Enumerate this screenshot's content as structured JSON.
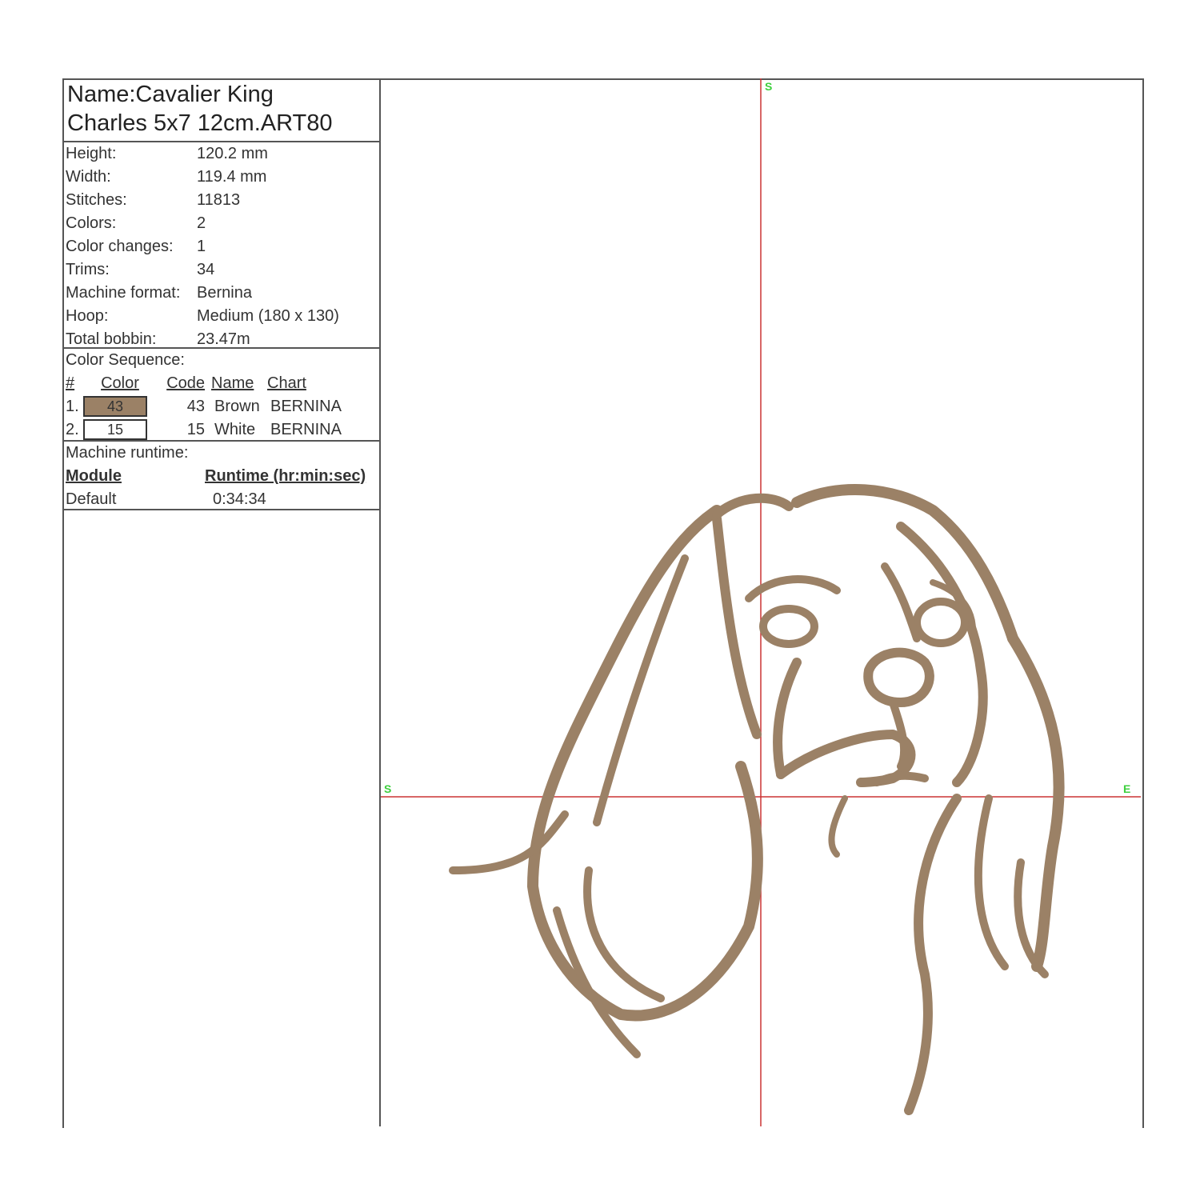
{
  "info": {
    "name_line1": "Name:Cavalier King",
    "name_line2": "Charles 5x7 12cm.ART80",
    "stats": [
      {
        "label": "Height:",
        "value": "120.2 mm"
      },
      {
        "label": "Width:",
        "value": "119.4 mm"
      },
      {
        "label": "Stitches:",
        "value": "11813"
      },
      {
        "label": "Colors:",
        "value": "2"
      },
      {
        "label": "Color changes:",
        "value": "1"
      },
      {
        "label": "Trims:",
        "value": "34"
      },
      {
        "label": "Machine format:",
        "value": "Bernina"
      },
      {
        "label": "Hoop:",
        "value": "Medium (180 x 130)"
      },
      {
        "label": "Total bobbin:",
        "value": "23.47m"
      }
    ],
    "color_sequence": {
      "title": "Color Sequence:",
      "headers": {
        "num": "#",
        "color": "Color",
        "code": "Code",
        "name": "Name",
        "chart": "Chart"
      },
      "rows": [
        {
          "num": "1.",
          "swatch_label": "43",
          "swatch_color": "#9b8166",
          "code": "43",
          "name": "Brown",
          "chart": "BERNINA"
        },
        {
          "num": "2.",
          "swatch_label": "15",
          "swatch_color": "#ffffff",
          "code": "15",
          "name": "White",
          "chart": "BERNINA"
        }
      ]
    },
    "runtime": {
      "title": "Machine runtime:",
      "header_module": "Module",
      "header_runtime": "Runtime (hr:min:sec)",
      "module": "Default",
      "value": "0:34:34"
    }
  },
  "canvas": {
    "marker_top": "S",
    "marker_left": "S",
    "marker_right": "E",
    "thread_color": "#9b8166",
    "crosshair_color": "#cc3333"
  }
}
